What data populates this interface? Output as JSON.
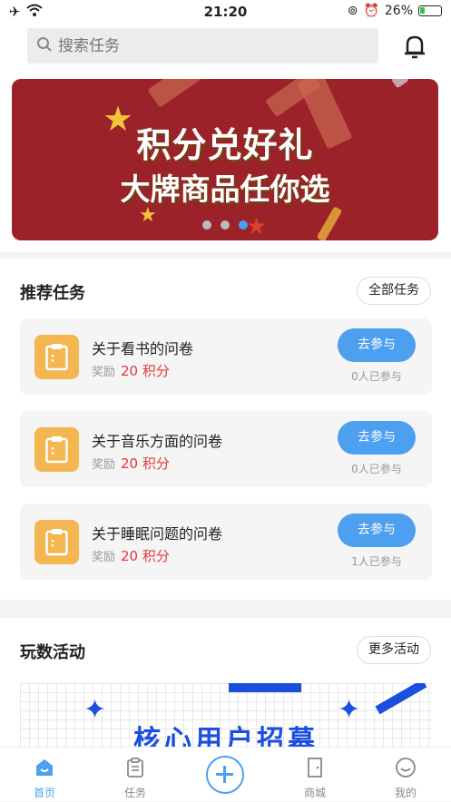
{
  "status_bar": {
    "time": "21:20",
    "battery_pct": "26%",
    "battery_level": 0.26
  },
  "search": {
    "placeholder": "搜索任务"
  },
  "banner": {
    "title": "积分兑好礼",
    "subtitle": "大牌商品任你选",
    "slides": 3,
    "active_slide": 2
  },
  "recommended": {
    "title": "推荐任务",
    "all_label": "全部任务",
    "tasks": [
      {
        "name": "关于看书的问卷",
        "reward_label": "奖励",
        "reward": "20 积分",
        "button": "去参与",
        "participants": "0人已参与"
      },
      {
        "name": "关于音乐方面的问卷",
        "reward_label": "奖励",
        "reward": "20 积分",
        "button": "去参与",
        "participants": "0人已参与"
      },
      {
        "name": "关于睡眠问题的问卷",
        "reward_label": "奖励",
        "reward": "20 积分",
        "button": "去参与",
        "participants": "1人已参与"
      }
    ]
  },
  "activities": {
    "title": "玩数活动",
    "more_label": "更多活动",
    "promo_text": "核心用户招募"
  },
  "tabbar": {
    "items": [
      {
        "label": "首页",
        "icon": "home-icon",
        "active": true
      },
      {
        "label": "任务",
        "icon": "clipboard-icon",
        "active": false
      },
      {
        "label": "",
        "icon": "add-circle-icon",
        "active": false
      },
      {
        "label": "商城",
        "icon": "door-icon",
        "active": false
      },
      {
        "label": "我的",
        "icon": "smiley-icon",
        "active": false
      }
    ]
  },
  "colors": {
    "accent": "#4d9ff0",
    "banner_bg": "#9c2229",
    "task_icon": "#f4b651",
    "reward": "#e0393e",
    "promo_text": "#1b4fe0"
  }
}
